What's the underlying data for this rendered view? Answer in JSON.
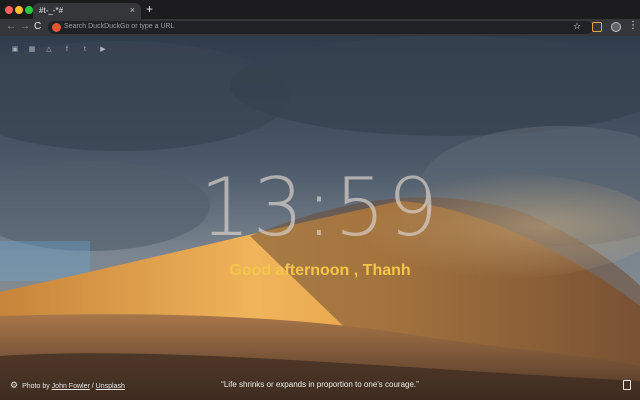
{
  "browser": {
    "tab_title": "#t-_-*#",
    "tab_close": "×",
    "new_tab": "+",
    "back": "←",
    "forward": "→",
    "reload": "C",
    "address_placeholder": "Search DuckDuckGo or type a URL",
    "star": "☆",
    "menu": "⋮"
  },
  "social_icons": [
    "image-icon",
    "calendar-icon",
    "drive-icon",
    "facebook-icon",
    "twitter-icon",
    "youtube-icon"
  ],
  "clock": {
    "time": "13:59"
  },
  "greeting": "Good afternoon , Thanh",
  "footer": {
    "photo_prefix": "Photo by",
    "photographer": "John Fowler",
    "separator": "/",
    "source": "Unsplash",
    "quote": "“Life shrinks or expands in proportion to one's courage.”"
  },
  "colors": {
    "greeting": "#f5c64a",
    "clock": "#d7cdc8"
  }
}
